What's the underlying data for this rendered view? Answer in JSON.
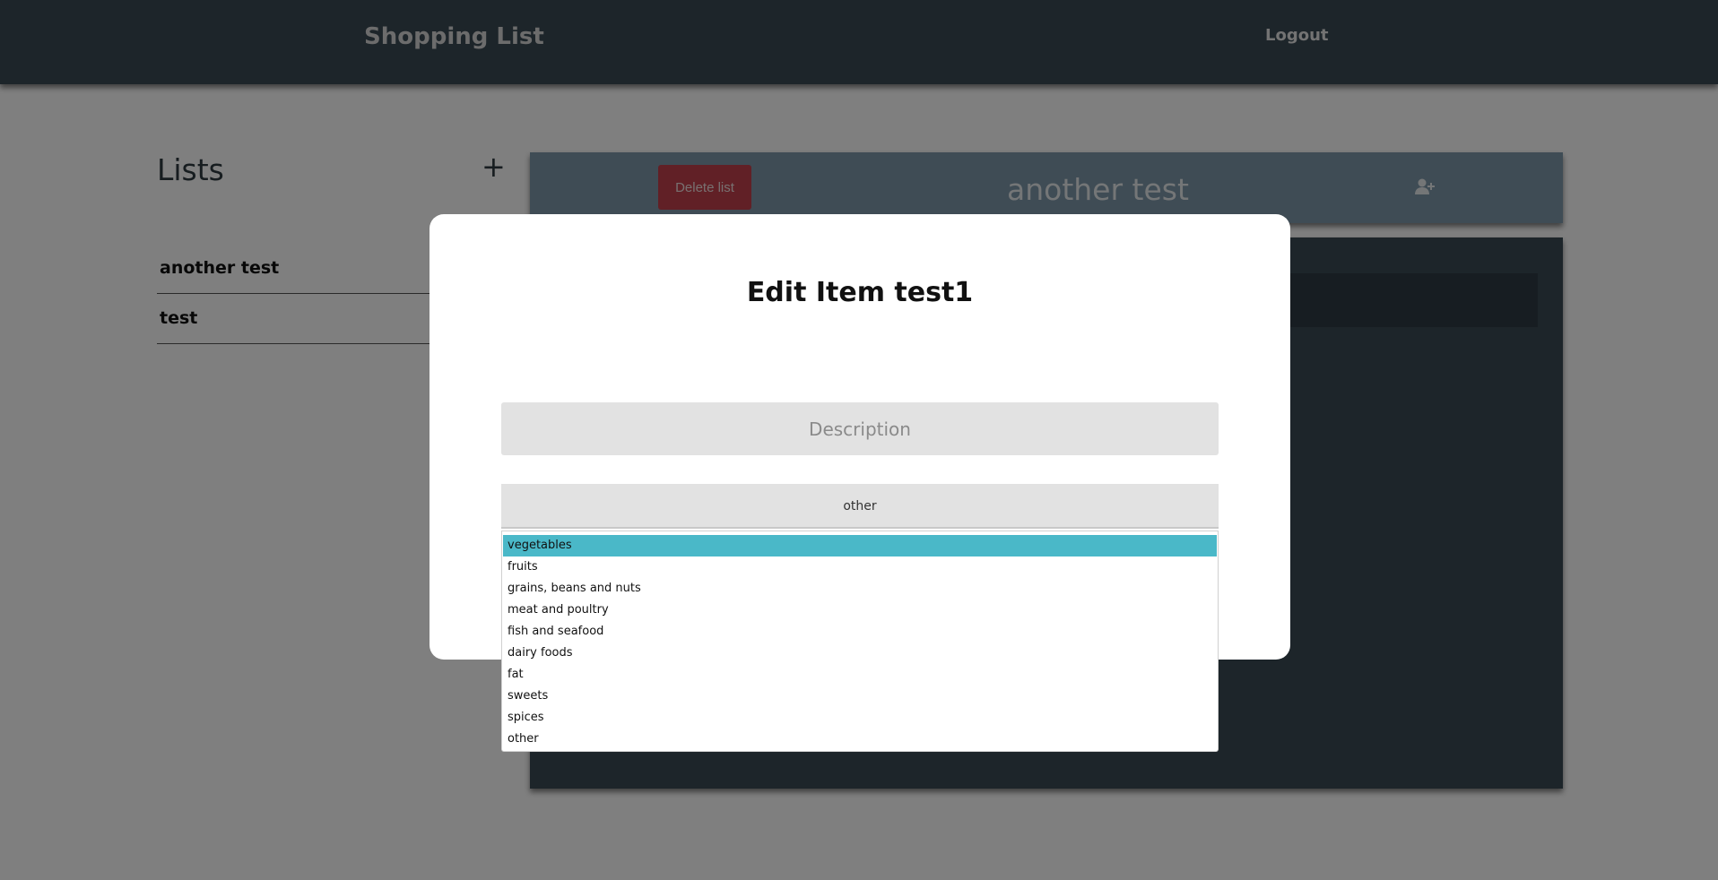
{
  "header": {
    "title": "Shopping List",
    "logout_label": "Logout"
  },
  "sidebar": {
    "title": "Lists",
    "add_icon": "+",
    "items": [
      {
        "label": "another test"
      },
      {
        "label": "test"
      }
    ]
  },
  "list_panel": {
    "delete_label": "Delete list",
    "name": "another test",
    "share_icon": "user-plus-icon"
  },
  "modal": {
    "title": "Edit Item test1",
    "description_placeholder": "Description",
    "category_value": "other",
    "category_options": [
      "vegetables",
      "fruits",
      "grains, beans and nuts",
      "meat and poultry",
      "fish and seafood",
      "dairy foods",
      "fat",
      "sweets",
      "spices",
      "other"
    ],
    "highlighted_option": "vegetables"
  },
  "colors": {
    "header_bg": "#3a4a55",
    "delete_red": "#c2414d",
    "highlight": "#4ab8c8"
  }
}
